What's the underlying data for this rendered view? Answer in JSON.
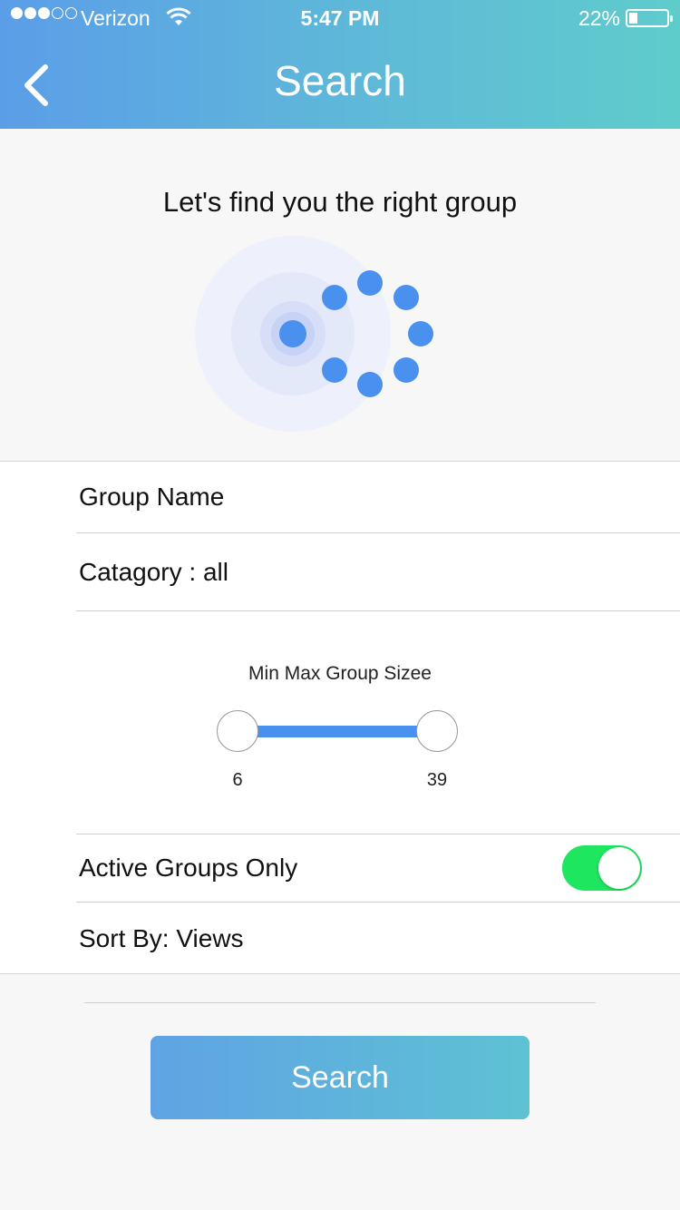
{
  "status_bar": {
    "carrier": "Verizon",
    "time": "5:47 PM",
    "battery": "22%",
    "battery_level": 0.22
  },
  "header": {
    "title": "Search",
    "back_icon": "chevron-left-icon"
  },
  "hero": {
    "text": "Let's find you the right group",
    "icon": "radar-icon"
  },
  "form": {
    "group_name_label": "Group Name",
    "category_label": "Catagory : all",
    "slider": {
      "label": "Min Max Group Sizee",
      "min_value": "6",
      "max_value": "39"
    },
    "active_groups_label": "Active Groups Only",
    "active_groups_on": true,
    "sort_label": "Sort By: Views"
  },
  "search_button_label": "Search",
  "colors": {
    "accent": "#4a90ee",
    "toggle_on": "#1ee65f",
    "header_gradient_start": "#5b9ee8",
    "header_gradient_end": "#5fcccc"
  }
}
